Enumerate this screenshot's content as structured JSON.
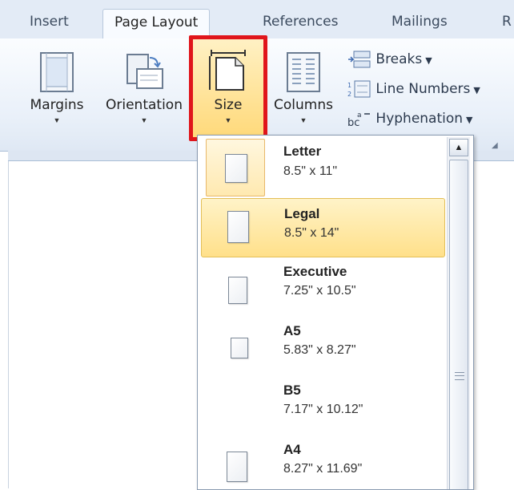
{
  "tabs": [
    "Insert",
    "Page Layout",
    "References",
    "Mailings",
    "R"
  ],
  "active_tab": "Page Layout",
  "ribbon": {
    "margins": "Margins",
    "orientation": "Orientation",
    "size": "Size",
    "columns": "Columns",
    "breaks": "Breaks",
    "line_numbers": "Line Numbers",
    "hyphenation": "Hyphenation"
  },
  "highlight_color": "#e0151b",
  "sizes": [
    {
      "name": "Letter",
      "dims": "8.5\" x 11\"",
      "selected": true
    },
    {
      "name": "Legal",
      "dims": "8.5\" x 14\"",
      "hovered": true
    },
    {
      "name": "Executive",
      "dims": "7.25\" x 10.5\""
    },
    {
      "name": "A5",
      "dims": "5.83\" x 8.27\""
    },
    {
      "name": "B5",
      "dims": "7.17\" x 10.12\""
    },
    {
      "name": "A4",
      "dims": "8.27\" x 11.69\""
    }
  ]
}
